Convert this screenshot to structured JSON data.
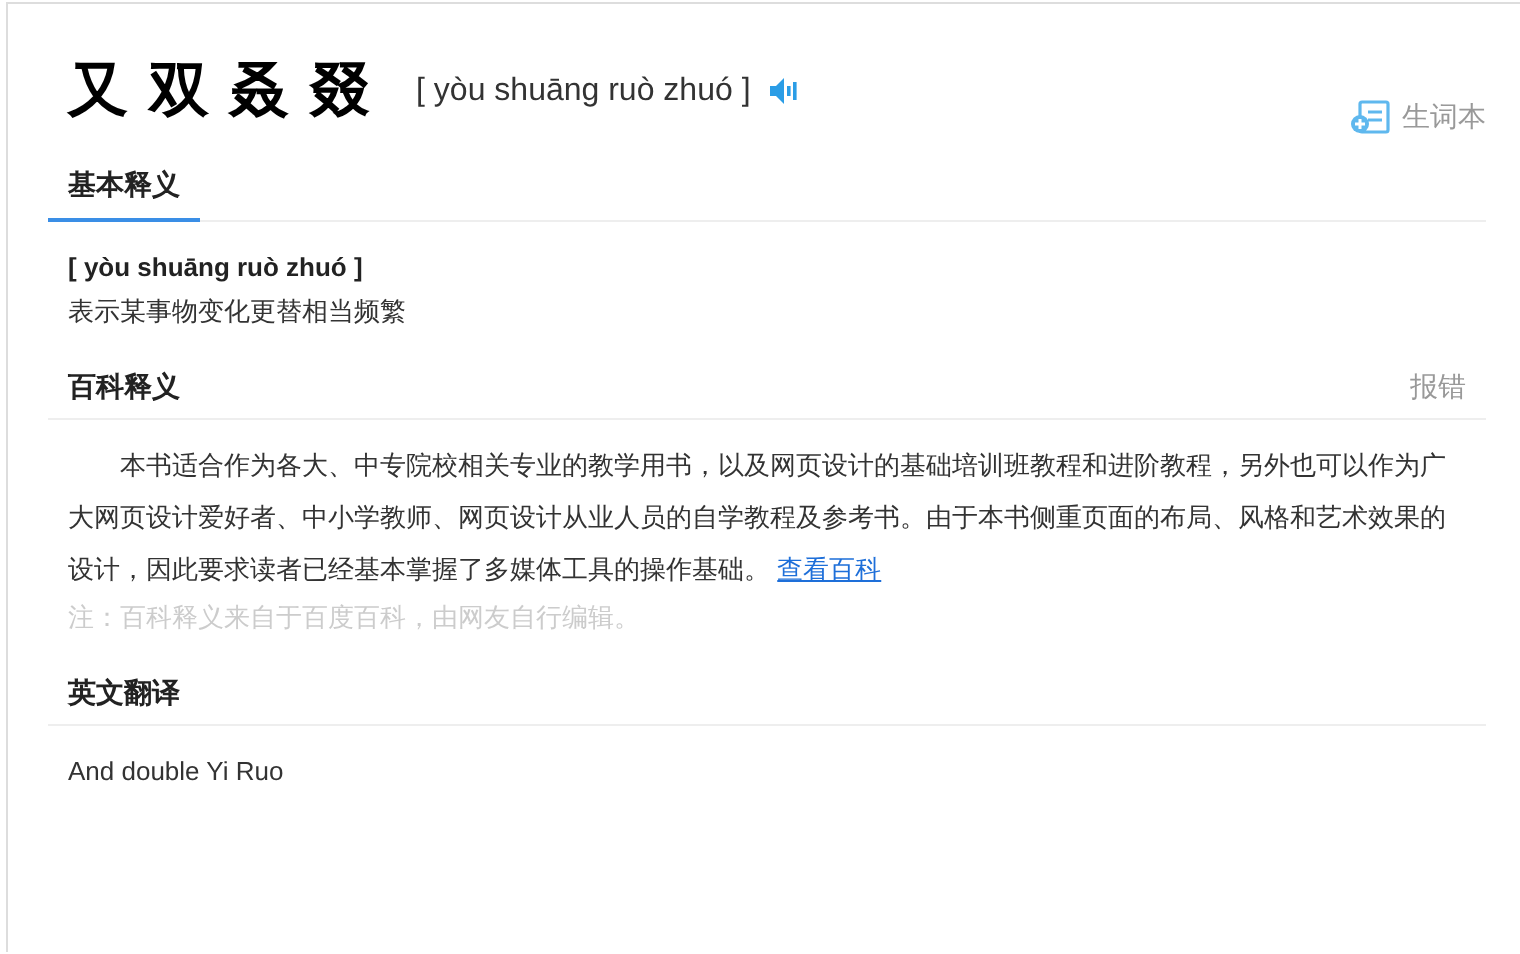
{
  "header": {
    "word": "又双叒叕",
    "pinyin": "[ yòu shuāng ruò zhuó ]",
    "wordbook": "生词本"
  },
  "tabs": [
    {
      "label": "基本释义",
      "selected": true
    }
  ],
  "basic": {
    "pinyin": "[ yòu shuāng ruò zhuó ]",
    "meaning": "表示某事物变化更替相当频繁"
  },
  "encyclopedia": {
    "title": "百科释义",
    "report": "报错",
    "text": "本书适合作为各大、中专院校相关专业的教学用书，以及网页设计的基础培训班教程和进阶教程，另外也可以作为广大网页设计爱好者、中小学教师、网页设计从业人员的自学教程及参考书。由于本书侧重页面的布局、风格和艺术效果的设计，因此要求读者已经基本掌握了多媒体工具的操作基础。",
    "link": "查看百科",
    "note": "注：百科释义来自于百度百科，由网友自行编辑。"
  },
  "translation": {
    "title": "英文翻译",
    "text": "And double Yi Ruo"
  }
}
